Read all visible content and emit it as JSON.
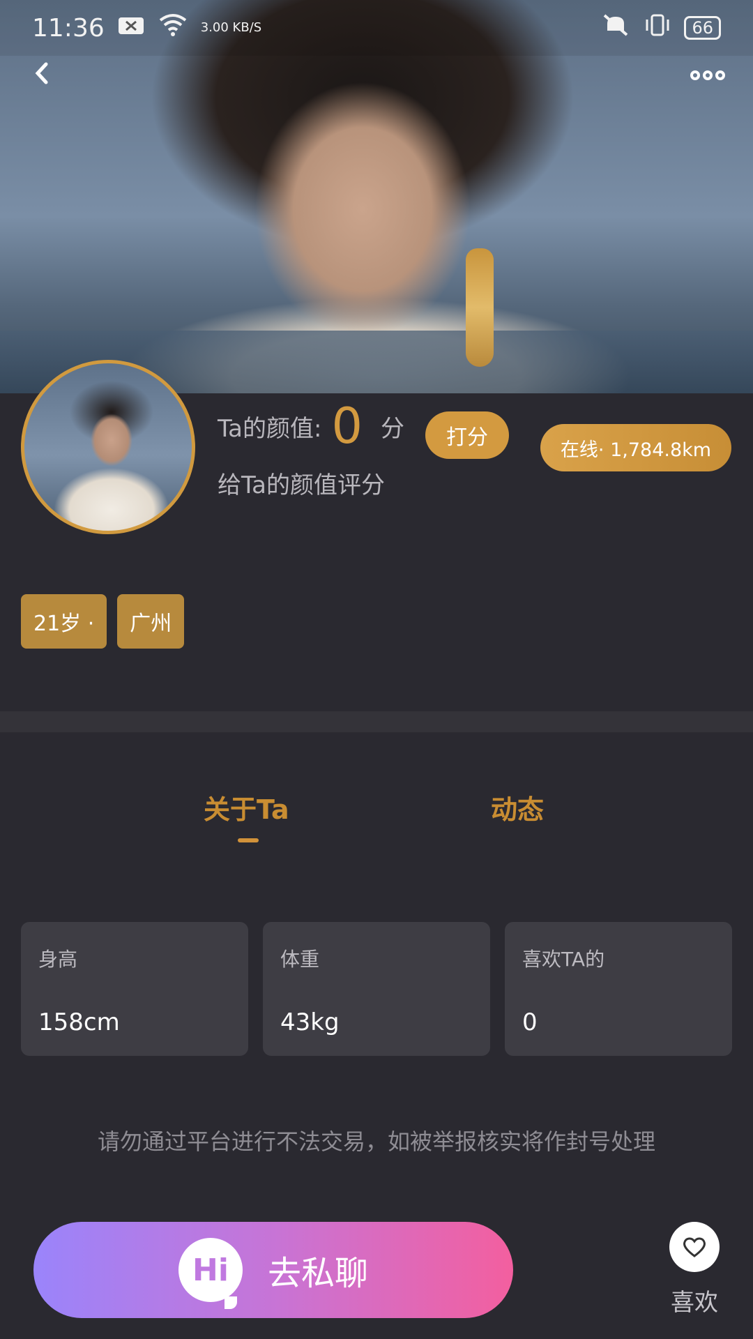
{
  "status_bar": {
    "time": "11:36",
    "network_speed": "3.00 KB/S",
    "battery": "66",
    "icons": [
      "notification-icon",
      "wifi-icon",
      "mute-icon",
      "vibrate-icon",
      "battery-icon"
    ]
  },
  "header": {
    "icons": [
      "back-icon",
      "more-icon"
    ]
  },
  "profile": {
    "score_label": "Ta的颜值:",
    "score_value": "0",
    "score_unit": "分",
    "rate_button": "打分",
    "rate_hint": "给Ta的颜值评分",
    "online_status": "在线· 1,784.8km",
    "tags": [
      "21岁 ·",
      "广州"
    ]
  },
  "tabs": [
    {
      "label": "关于Ta",
      "active": true
    },
    {
      "label": "动态",
      "active": false
    }
  ],
  "stats": [
    {
      "label": "身高",
      "value": "158cm"
    },
    {
      "label": "体重",
      "value": "43kg"
    },
    {
      "label": "喜欢TA的",
      "value": "0"
    }
  ],
  "notice": "请勿通过平台进行不法交易，如被举报核实将作封号处理",
  "actions": {
    "chat_icon_text": "Hi",
    "chat_label": "去私聊",
    "like_label": "喜欢"
  },
  "colors": {
    "accent": "#d39a40",
    "background": "#2a2930",
    "card": "#3e3d44"
  }
}
